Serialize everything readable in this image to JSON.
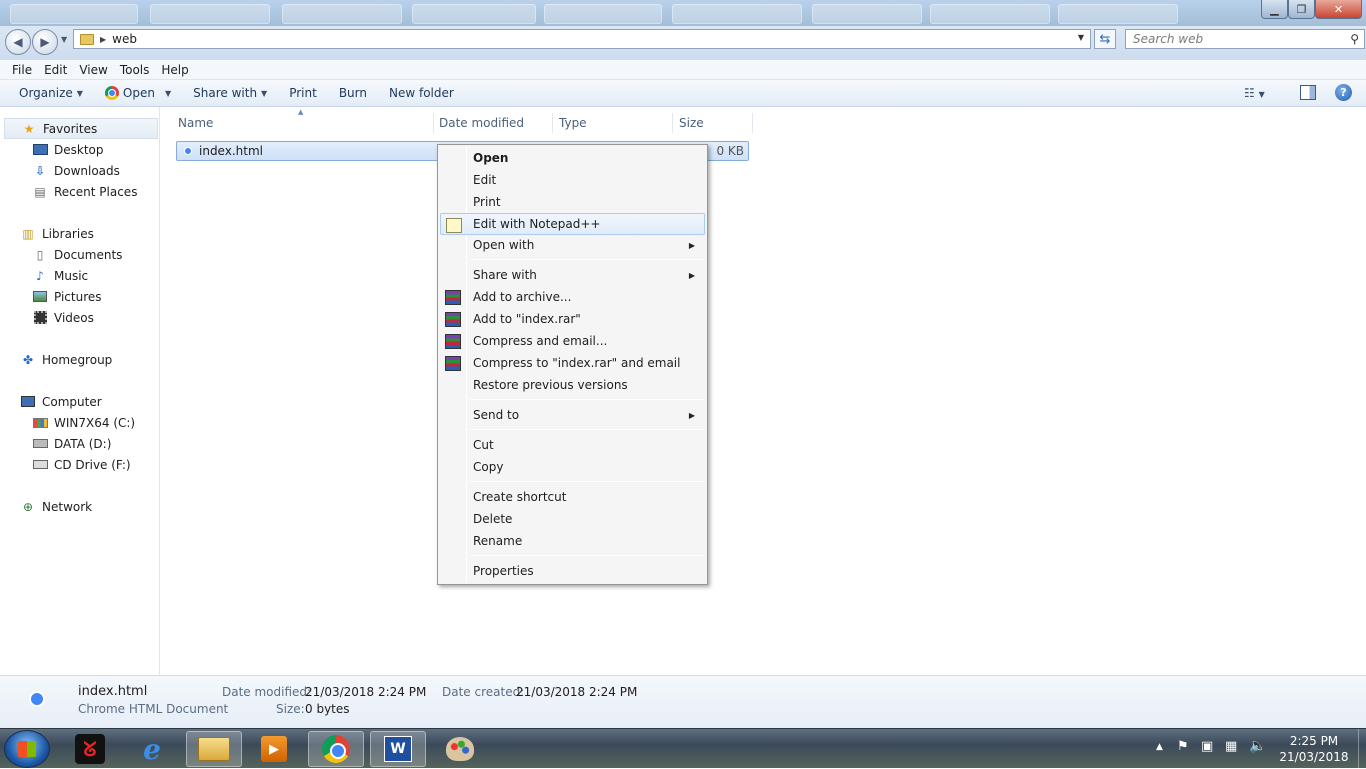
{
  "address": {
    "path": "web",
    "search_placeholder": "Search web"
  },
  "menu": [
    "File",
    "Edit",
    "View",
    "Tools",
    "Help"
  ],
  "toolbar": {
    "organize": "Organize",
    "open": "Open",
    "share_with": "Share with",
    "print": "Print",
    "burn": "Burn",
    "new_folder": "New folder"
  },
  "nav": {
    "favorites": "Favorites",
    "desktop": "Desktop",
    "downloads": "Downloads",
    "recent_places": "Recent Places",
    "libraries": "Libraries",
    "documents": "Documents",
    "music": "Music",
    "pictures": "Pictures",
    "videos": "Videos",
    "homegroup": "Homegroup",
    "computer": "Computer",
    "drive_c": "WIN7X64 (C:)",
    "drive_d": "DATA (D:)",
    "drive_f": "CD Drive (F:)",
    "network": "Network"
  },
  "columns": {
    "name": "Name",
    "date_modified": "Date modified",
    "type": "Type",
    "size": "Size"
  },
  "file": {
    "name": "index.html",
    "size": "0 KB"
  },
  "context_menu": {
    "open": "Open",
    "edit": "Edit",
    "print": "Print",
    "edit_notepad": "Edit with Notepad++",
    "open_with": "Open with",
    "share_with": "Share with",
    "add_archive": "Add to archive...",
    "add_rar": "Add to \"index.rar\"",
    "compress_email": "Compress and email...",
    "compress_rar_email": "Compress to \"index.rar\" and email",
    "restore": "Restore previous versions",
    "send_to": "Send to",
    "cut": "Cut",
    "copy": "Copy",
    "create_shortcut": "Create shortcut",
    "delete": "Delete",
    "rename": "Rename",
    "properties": "Properties"
  },
  "details": {
    "filename": "index.html",
    "filetype": "Chrome HTML Document",
    "date_modified_label": "Date modified:",
    "date_modified": "21/03/2018 2:24 PM",
    "date_created_label": "Date created:",
    "date_created": "21/03/2018 2:24 PM",
    "size_label": "Size:",
    "size": "0 bytes"
  },
  "clock": {
    "time": "2:25 PM",
    "date": "21/03/2018"
  }
}
